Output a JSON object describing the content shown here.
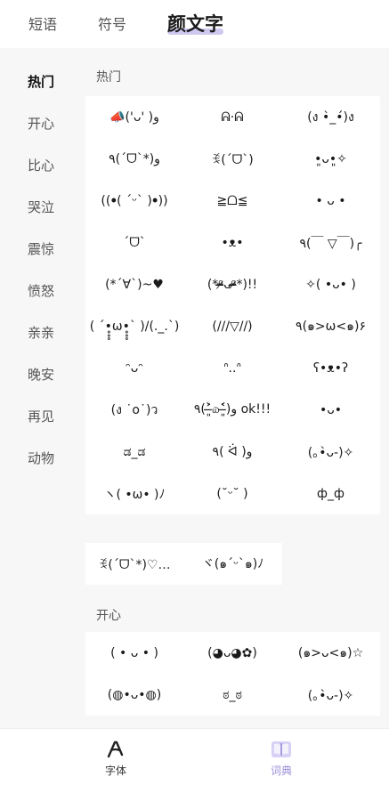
{
  "top_tabs": [
    {
      "label": "短语",
      "active": false
    },
    {
      "label": "符号",
      "active": false
    },
    {
      "label": "颜文字",
      "active": true
    }
  ],
  "sidebar": {
    "items": [
      {
        "label": "热门",
        "active": true
      },
      {
        "label": "开心",
        "active": false
      },
      {
        "label": "比心",
        "active": false
      },
      {
        "label": "哭泣",
        "active": false
      },
      {
        "label": "震惊",
        "active": false
      },
      {
        "label": "愤怒",
        "active": false
      },
      {
        "label": "亲亲",
        "active": false
      },
      {
        "label": "晚安",
        "active": false
      },
      {
        "label": "再见",
        "active": false
      },
      {
        "label": "动物",
        "active": false
      }
    ]
  },
  "sections": [
    {
      "title": "热门",
      "items": [
        "📣('ᴗ' )و",
        "ᕱ·ᕱ",
        "(ง •̀_•́)ง",
        "٩(ˊᗜˋ*)و",
        "ꉂ(ˊᗜˋ)",
        "•͈ᴗ•͈✧",
        "((ꔷ( ´ᵕ` )ꔷ))",
        "≧ᗝ≦",
        "• ᴗ •",
        "ˊᗜˋ",
        "•ᴥ•",
        "٩(￣ ▽￣)╭",
        "(*´∀`)~♥",
        "(*ᵒ̴̶̷ᴗᵒ̴̶̷*)!!",
        "✧( •ᴗ• )",
        "( ´•̥̥̥ω•̥̥̥` )/(._.`)",
        "(///▽//)",
        "٩(๑>ω<๑)۶",
        "ᵔᴗᵔ",
        "ᐢ..ᐢ",
        "ʕ•ᴥ•ʔ",
        "(ง ˙o˙)ว",
        "٩(˃̶͈̀௰˂̶͈́)و ok!!!",
        "•ᴗ•",
        "ಡ_ಡ",
        "٩( ᐛ )و",
        "(｡•̀ᴗ-)✧",
        "ヽ( •ω• )ﾉ",
        "(˘ᵕ˘ )",
        "ф_ф"
      ],
      "tail": [
        "ꉂ(ˊᗜˋ*)♡…",
        "ヾ(๑ˊᵕˋ๑)ﾉ"
      ]
    },
    {
      "title": "开心",
      "items": [
        "( • ᴗ • )",
        "(◕ᴗ◕✿)",
        "(๑>ᴗ<๑)☆",
        "(◍•ᴗ•◍)",
        "ಠ_ಠ",
        "(｡•̀ᴗ-)✧"
      ]
    }
  ],
  "bottom_nav": [
    {
      "label": "字体",
      "icon": "font-a-icon",
      "active": false
    },
    {
      "label": "词典",
      "icon": "book-icon",
      "active": true
    }
  ],
  "colors": {
    "accent": "#9b8fd9",
    "active_tab_highlight": "#cfc8f0",
    "background": "#f7f7f8",
    "card": "#ffffff"
  }
}
